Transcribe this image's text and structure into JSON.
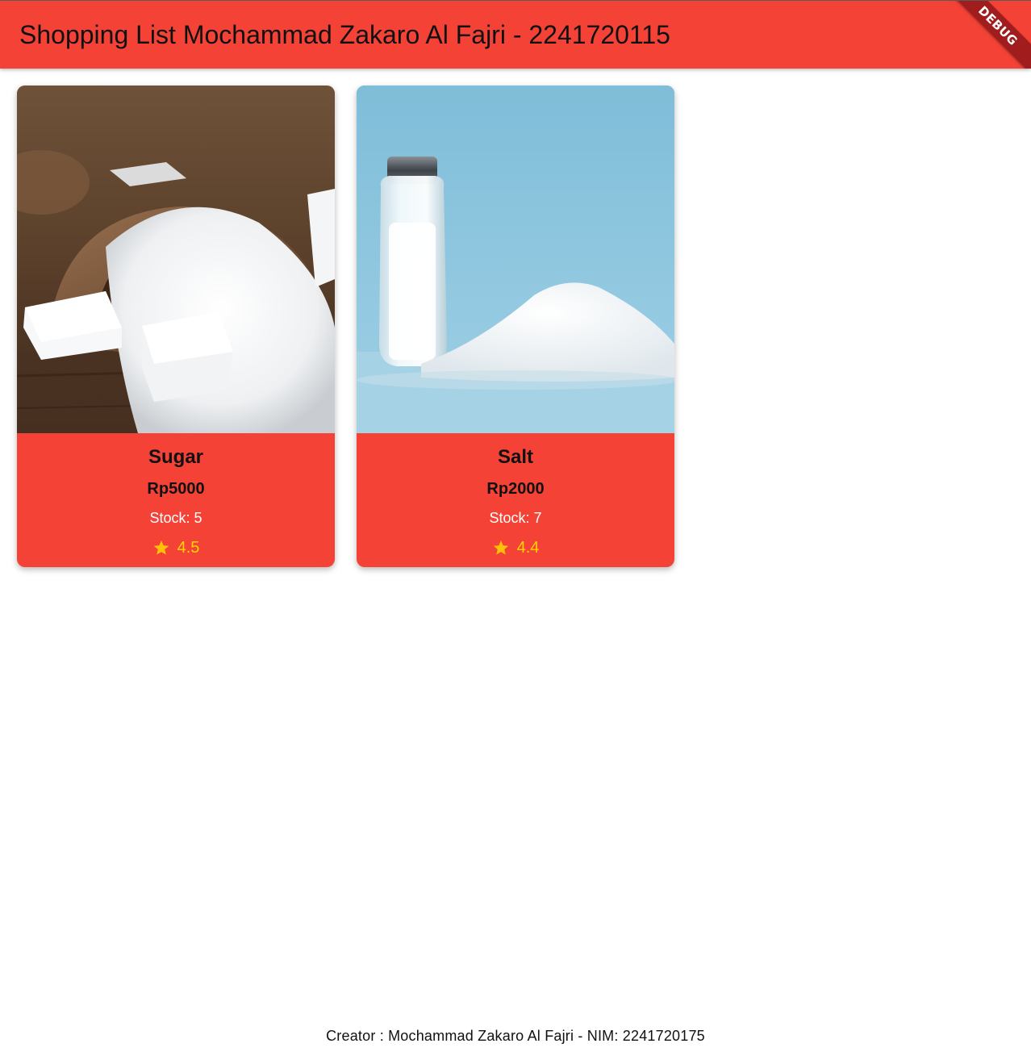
{
  "app_bar": {
    "title": "Shopping List Mochammad Zakaro Al Fajri - 2241720115",
    "debug_banner": "DEBUG",
    "color": "#f44336"
  },
  "items": [
    {
      "name": "Sugar",
      "price": "Rp5000",
      "stock": "Stock: 5",
      "rating": "4.5",
      "image": "sugar-photo"
    },
    {
      "name": "Salt",
      "price": "Rp2000",
      "stock": "Stock: 7",
      "rating": "4.4",
      "image": "salt-photo"
    }
  ],
  "footer": {
    "text": "Creator : Mochammad Zakaro Al Fajri - NIM: 2241720175"
  },
  "colors": {
    "card_background": "#f44336",
    "rating_star": "#ffc107",
    "rating_text": "#ffd400"
  }
}
